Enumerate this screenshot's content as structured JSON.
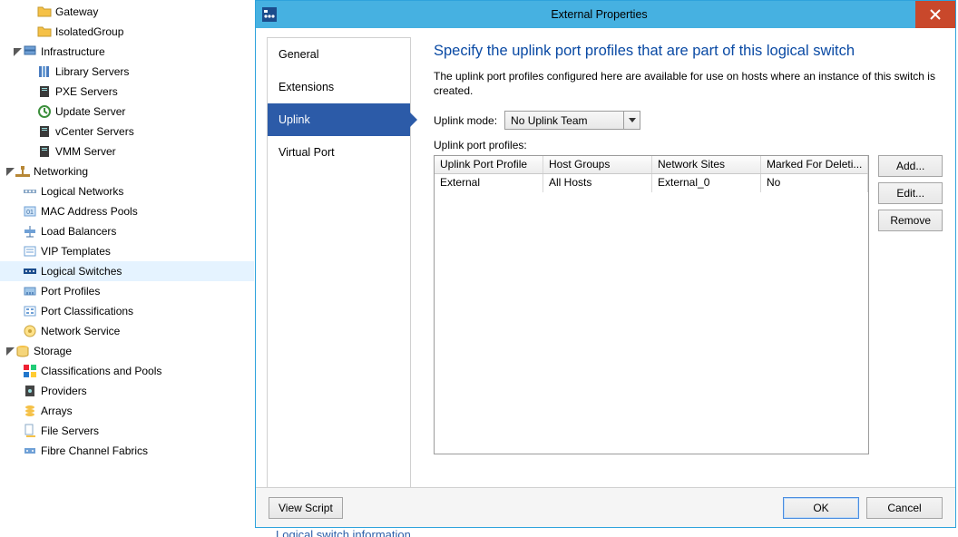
{
  "tree": {
    "items": [
      {
        "level": 2,
        "icon": "folder",
        "label": "Gateway"
      },
      {
        "level": 2,
        "icon": "folder",
        "label": "IsolatedGroup"
      },
      {
        "level": 1,
        "icon": "servers",
        "label": "Infrastructure",
        "expandable": true
      },
      {
        "level": 2,
        "icon": "library",
        "label": "Library Servers"
      },
      {
        "level": 2,
        "icon": "server",
        "label": "PXE Servers"
      },
      {
        "level": 2,
        "icon": "update",
        "label": "Update Server"
      },
      {
        "level": 2,
        "icon": "server",
        "label": "vCenter Servers"
      },
      {
        "level": 2,
        "icon": "server",
        "label": "VMM Server"
      },
      {
        "level": 0,
        "icon": "network",
        "label": "Networking",
        "expandable": true
      },
      {
        "level": 1,
        "icon": "logical-net",
        "label": "Logical Networks"
      },
      {
        "level": 1,
        "icon": "mac",
        "label": "MAC Address Pools"
      },
      {
        "level": 1,
        "icon": "load-balancer",
        "label": "Load Balancers"
      },
      {
        "level": 1,
        "icon": "vip",
        "label": "VIP Templates"
      },
      {
        "level": 1,
        "icon": "logical-switch",
        "label": "Logical Switches",
        "selected": true
      },
      {
        "level": 1,
        "icon": "port-profile",
        "label": "Port Profiles"
      },
      {
        "level": 1,
        "icon": "port-class",
        "label": "Port Classifications"
      },
      {
        "level": 1,
        "icon": "net-service",
        "label": "Network Service"
      },
      {
        "level": 0,
        "icon": "storage",
        "label": "Storage",
        "expandable": true
      },
      {
        "level": 1,
        "icon": "class-pool",
        "label": "Classifications and Pools"
      },
      {
        "level": 1,
        "icon": "provider",
        "label": "Providers"
      },
      {
        "level": 1,
        "icon": "arrays",
        "label": "Arrays"
      },
      {
        "level": 1,
        "icon": "file-server",
        "label": "File Servers"
      },
      {
        "level": 1,
        "icon": "fibre",
        "label": "Fibre Channel Fabrics"
      }
    ]
  },
  "dialog": {
    "title": "External Properties",
    "nav": [
      {
        "label": "General"
      },
      {
        "label": "Extensions"
      },
      {
        "label": "Uplink",
        "selected": true
      },
      {
        "label": "Virtual Port"
      }
    ],
    "heading": "Specify the uplink port profiles that are part of this logical switch",
    "description": "The uplink port profiles configured here are available for use on hosts where an instance of this switch is created.",
    "uplink_mode_label": "Uplink mode:",
    "uplink_mode_value": "No Uplink Team",
    "profiles_label": "Uplink port profiles:",
    "columns": [
      "Uplink Port Profile",
      "Host Groups",
      "Network Sites",
      "Marked For Deleti..."
    ],
    "rows": [
      {
        "profile": "External",
        "host_groups": "All Hosts",
        "sites": "External_0",
        "marked": "No"
      }
    ],
    "side_buttons": {
      "add": "Add...",
      "edit": "Edit...",
      "remove": "Remove"
    },
    "footer": {
      "view_script": "View Script",
      "ok": "OK",
      "cancel": "Cancel"
    }
  },
  "status_text": "Logical switch information"
}
